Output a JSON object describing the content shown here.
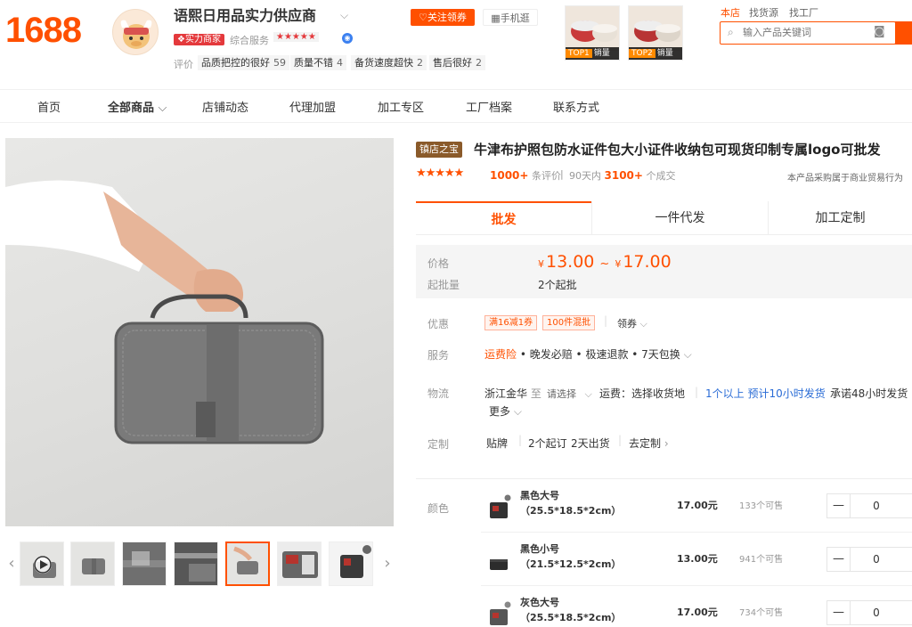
{
  "brand": {
    "logo": "1688"
  },
  "shop": {
    "name": "语熙日用品实力供应商",
    "badge": "实力商家",
    "service_label": "综合服务",
    "service_stars": "★★★★★",
    "eval_label": "评价",
    "eval_tags": [
      {
        "label": "品质把控的很好",
        "count": "59"
      },
      {
        "label": "质量不错",
        "count": "4"
      },
      {
        "label": "备货速度超快",
        "count": "2"
      },
      {
        "label": "售后很好",
        "count": "2"
      }
    ],
    "follow_label": "关注领券",
    "mobile_label": "手机逛"
  },
  "top_products": [
    {
      "rank": "TOP1",
      "label": "销量"
    },
    {
      "rank": "TOP2",
      "label": "销量"
    }
  ],
  "search": {
    "tabs": [
      "本店",
      "找货源",
      "找工厂"
    ],
    "placeholder": "输入产品关键词"
  },
  "nav": [
    "首页",
    "全部商品",
    "店铺动态",
    "代理加盟",
    "加工专区",
    "工厂档案",
    "联系方式"
  ],
  "product": {
    "tag": "镇店之宝",
    "title": "牛津布护照包防水证件包大小证件收纳包可现货印制专属logo可批发",
    "stars": "★★★★★",
    "reviews_count": "1000+",
    "reviews_label": "条评价",
    "sep": "|",
    "days_label": "90天内",
    "deals_count": "3100+",
    "deals_label": "个成交",
    "biz_note": "本产品采购属于商业贸易行为"
  },
  "tabs": [
    "批发",
    "一件代发",
    "加工定制"
  ],
  "price": {
    "label": "价格",
    "currency": "¥",
    "low": "13.00",
    "tilde": "~",
    "high": "17.00",
    "moq_label": "起批量",
    "moq_value": "2个起批"
  },
  "discount": {
    "label": "优惠",
    "coupons": [
      "满16减1券",
      "100件混批"
    ],
    "get_label": "领券"
  },
  "service": {
    "label": "服务",
    "insurance": "运费险",
    "items": "• 晚发必赔 • 极速退款 • 7天包换"
  },
  "logistics": {
    "label": "物流",
    "from": "浙江金华",
    "to_label": "至",
    "select_label": "请选择",
    "fee_label": "运费：选择收货地",
    "ship_note": "1个以上 预计10小时发货",
    "promise": "承诺48小时发货",
    "more": "更多"
  },
  "custom": {
    "label": "定制",
    "type": "贴牌",
    "moq": "2个起订",
    "days": "2天出货",
    "link": "去定制"
  },
  "sku": {
    "label": "颜色",
    "items": [
      {
        "name": "黑色大号（25.5*18.5*2cm）",
        "price": "17.00元",
        "stock": "133个可售",
        "qty": "0"
      },
      {
        "name": "黑色小号（21.5*12.5*2cm）",
        "price": "13.00元",
        "stock": "941个可售",
        "qty": "0"
      },
      {
        "name": "灰色大号（25.5*18.5*2cm）",
        "price": "17.00元",
        "stock": "734个可售",
        "qty": "0"
      }
    ]
  }
}
